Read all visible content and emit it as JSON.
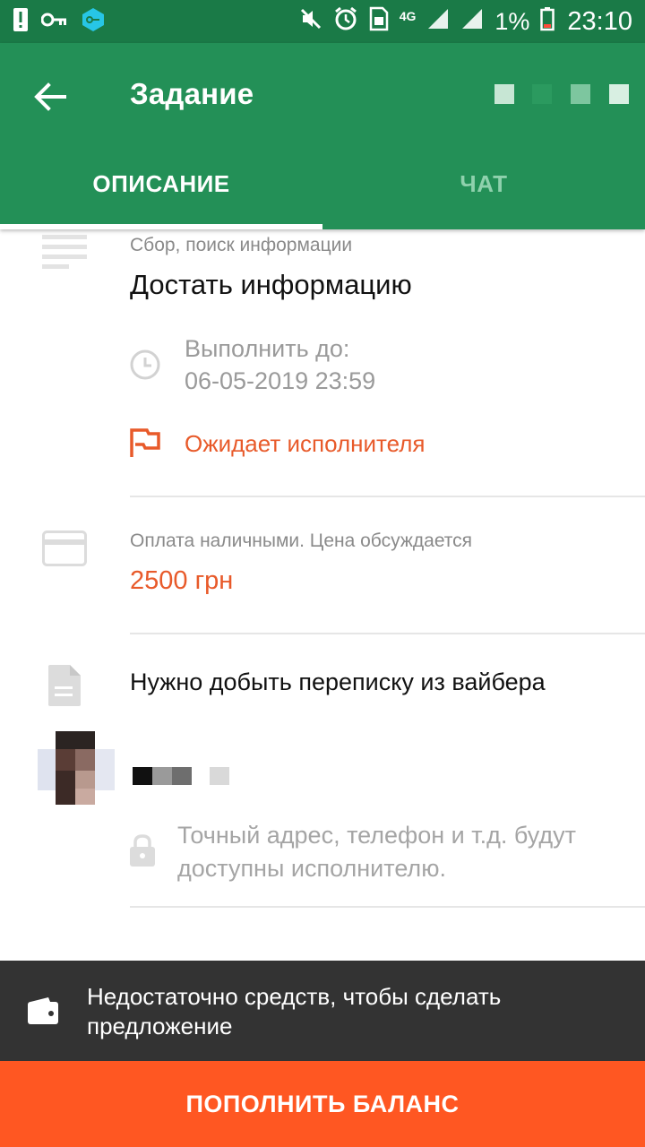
{
  "status_bar": {
    "network": "4G",
    "battery_percent": "1%",
    "time": "23:10"
  },
  "app_bar": {
    "title": "Задание",
    "tabs": [
      {
        "label": "ОПИСАНИЕ",
        "active": true
      },
      {
        "label": "ЧАТ",
        "active": false
      }
    ]
  },
  "task": {
    "category": "Сбор, поиск информации",
    "title": "Достать информацию",
    "deadline_label": "Выполнить до:",
    "deadline_value": "06-05-2019 23:59",
    "status": "Ожидает исполнителя"
  },
  "payment": {
    "label": "Оплата наличными. Цена обсуждается",
    "price": "2500 грн"
  },
  "description": {
    "text": "Нужно добыть переписку из вайбера"
  },
  "customer": {
    "privacy_note": "Точный адрес, телефон и т.д. будут доступны исполнителю."
  },
  "snackbar": {
    "text": "Недостаточно средств, чтобы сделать предложение"
  },
  "bottom_button": {
    "label": "ПОПОЛНИТЬ БАЛАНС"
  },
  "colors": {
    "status_bar": "#1a7a47",
    "app_bar": "#239057",
    "accent_orange": "#e85a2a",
    "button_orange": "#ff5722",
    "snackbar": "#333333"
  }
}
